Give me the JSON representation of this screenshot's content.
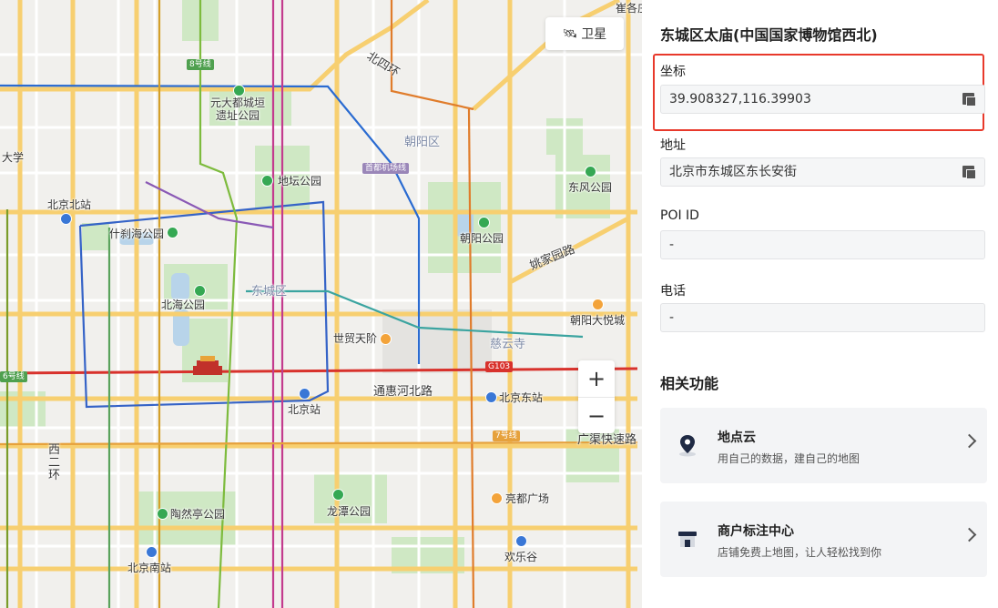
{
  "map": {
    "labels": {
      "cuijiazhuang": "崔各庄",
      "beisihuan": "北四环",
      "line8": "8号线",
      "yuan_dadu": "元大都城垣\n遗址公园",
      "chaoyang_district": "朝阳区",
      "capital_airport": "首都机场线",
      "daxue": "大学",
      "ditan": "地坛公园",
      "dongfeng": "东风公园",
      "beijing_north": "北京北站",
      "shichahai": "什刹海公园",
      "chaoyang_park": "朝阳公园",
      "yaojiayuan": "姚家园路",
      "beihai": "北海公园",
      "dongcheng": "东城区",
      "chaoyang_joycity": "朝阳大悦城",
      "shimao": "世贸天阶",
      "ciyunsi": "慈云寺",
      "line6": "6号线",
      "g103": "G103",
      "tonghuihe": "通惠河北路",
      "beijing_station": "北京站",
      "beijing_east": "北京东站",
      "line7": "7号线",
      "guangqu": "广渠快速路",
      "xierhuan": "西\n二\n环",
      "liangma": "亮都广场",
      "taoranting": "陶然亭公园",
      "longtan": "龙潭公园",
      "beijing_south": "北京南站",
      "huanlegu": "欢乐谷"
    },
    "satellite_label": "卫星",
    "zoom_in": "+",
    "zoom_out": "−"
  },
  "panel": {
    "title": "东城区太庙(中国国家博物馆西北)",
    "coord_label": "坐标",
    "coord_value": "39.908327,116.39903",
    "address_label": "地址",
    "address_value": "北京市东城区东长安街",
    "poi_label": "POI ID",
    "poi_value": "-",
    "phone_label": "电话",
    "phone_value": "-",
    "related_title": "相关功能",
    "cards": [
      {
        "title": "地点云",
        "subtitle": "用自己的数据，建自己的地图",
        "icon": "location-pin-icon"
      },
      {
        "title": "商户标注中心",
        "subtitle": "店铺免费上地图，让人轻松找到你",
        "icon": "storefront-icon"
      }
    ]
  },
  "colors": {
    "highlight": "#e8392b",
    "map_bg": "#f1f0ed",
    "park": "#cfe8c4",
    "ring_road": "#f7cf70",
    "main_road": "#ffffff"
  }
}
